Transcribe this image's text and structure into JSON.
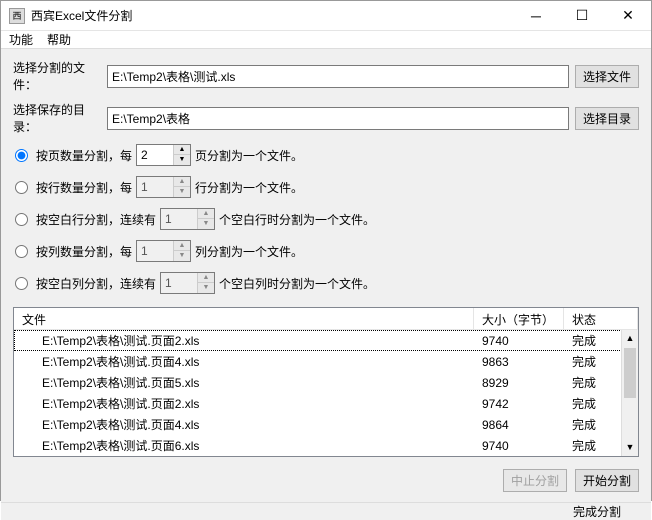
{
  "window": {
    "title": "西宾Excel文件分割"
  },
  "menu": {
    "function": "功能",
    "help": "帮助"
  },
  "labels": {
    "select_file": "选择分割的文件：",
    "select_dir": "选择保存的目录："
  },
  "inputs": {
    "file_path": "E:\\Temp2\\表格\\测试.xls",
    "dir_path": "E:\\Temp2\\表格"
  },
  "buttons": {
    "choose_file": "选择文件",
    "choose_dir": "选择目录",
    "stop": "中止分割",
    "start": "开始分割"
  },
  "options": {
    "by_page": {
      "label_pre": "按页数量分割，每",
      "value": "2",
      "label_post": "页分割为一个文件。",
      "checked": true
    },
    "by_row": {
      "label_pre": "按行数量分割，每",
      "value": "1",
      "label_post": "行分割为一个文件。",
      "checked": false
    },
    "by_blank_row": {
      "label_pre": "按空白行分割，连续有",
      "value": "1",
      "label_post": "个空白行时分割为一个文件。",
      "checked": false
    },
    "by_col": {
      "label_pre": "按列数量分割，每",
      "value": "1",
      "label_post": "列分割为一个文件。",
      "checked": false
    },
    "by_blank_col": {
      "label_pre": "按空白列分割，连续有",
      "value": "1",
      "label_post": "个空白列时分割为一个文件。",
      "checked": false
    }
  },
  "list": {
    "headers": {
      "file": "文件",
      "size": "大小（字节）",
      "status": "状态"
    },
    "rows": [
      {
        "file": "E:\\Temp2\\表格\\测试.页面2.xls",
        "size": "9740",
        "status": "完成"
      },
      {
        "file": "E:\\Temp2\\表格\\测试.页面4.xls",
        "size": "9863",
        "status": "完成"
      },
      {
        "file": "E:\\Temp2\\表格\\测试.页面5.xls",
        "size": "8929",
        "status": "完成"
      },
      {
        "file": "E:\\Temp2\\表格\\测试.页面2.xls",
        "size": "9742",
        "status": "完成"
      },
      {
        "file": "E:\\Temp2\\表格\\测试.页面4.xls",
        "size": "9864",
        "status": "完成"
      },
      {
        "file": "E:\\Temp2\\表格\\测试.页面6.xls",
        "size": "9740",
        "status": "完成"
      }
    ]
  },
  "status": {
    "text": "完成分割"
  }
}
